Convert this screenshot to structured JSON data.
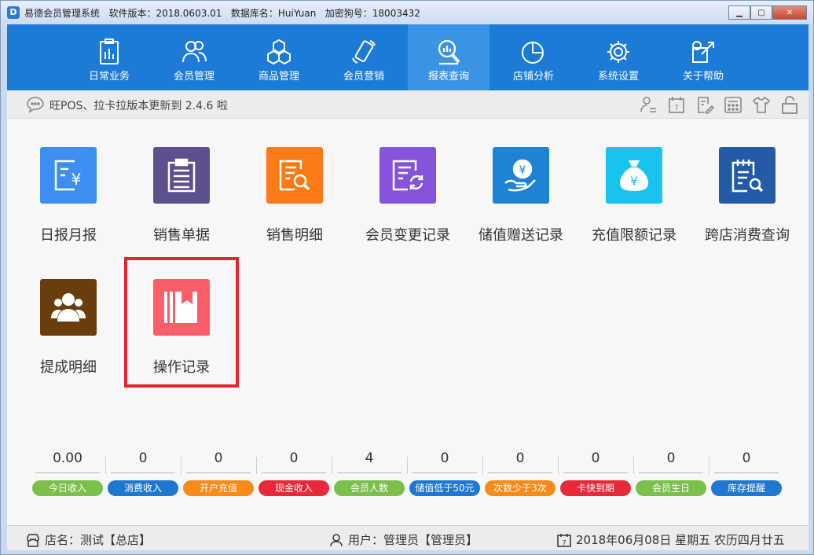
{
  "window": {
    "title": "易德会员管理系统   软件版本：2018.0603.01   数据库名：HuiYuan   加密狗号：18003432",
    "app_icon_glyph": "D"
  },
  "nav": {
    "items": [
      {
        "label": "日常业务",
        "icon": "clipboard-chart-icon"
      },
      {
        "label": "会员管理",
        "icon": "users-icon"
      },
      {
        "label": "商品管理",
        "icon": "boxes-icon"
      },
      {
        "label": "会员营销",
        "icon": "phone-icon"
      },
      {
        "label": "报表查询",
        "icon": "search-chart-icon"
      },
      {
        "label": "店铺分析",
        "icon": "pie-chart-icon"
      },
      {
        "label": "系统设置",
        "icon": "gear-icon"
      },
      {
        "label": "关于帮助",
        "icon": "help-icon"
      }
    ],
    "active_index": 4
  },
  "notice": {
    "text": "旺POS、拉卡拉版本更新到 2.4.6 啦",
    "icon": "chat-icon",
    "tools": [
      "user-switch-icon",
      "calendar-icon",
      "edit-icon",
      "calculator-icon",
      "shirt-icon",
      "lock-icon"
    ]
  },
  "reports": [
    {
      "label": "日报月报",
      "color": "#3d8ef0",
      "icon": "daily-report-icon"
    },
    {
      "label": "销售单据",
      "color": "#5e4f8e",
      "icon": "sales-receipt-icon"
    },
    {
      "label": "销售明细",
      "color": "#fb7a16",
      "icon": "sales-detail-icon"
    },
    {
      "label": "会员变更记录",
      "color": "#8653dc",
      "icon": "member-change-icon"
    },
    {
      "label": "储值赠送记录",
      "color": "#1e83d4",
      "icon": "stored-value-gift-icon"
    },
    {
      "label": "充值限额记录",
      "color": "#18c4ee",
      "icon": "money-bag-icon"
    },
    {
      "label": "跨店消费查询",
      "color": "#235ba7",
      "icon": "cross-store-icon"
    },
    {
      "label": "提成明细",
      "color": "#6a3e0c",
      "icon": "commission-icon"
    },
    {
      "label": "操作记录",
      "color": "#fb5e6b",
      "icon": "operation-log-icon"
    }
  ],
  "stats": [
    {
      "value": "0.00",
      "label": "今日收入",
      "color": "#7ac04a"
    },
    {
      "value": "0",
      "label": "消费收入",
      "color": "#1e78d2"
    },
    {
      "value": "0",
      "label": "开户充值",
      "color": "#f88a18"
    },
    {
      "value": "0",
      "label": "现金收入",
      "color": "#e8293a"
    },
    {
      "value": "4",
      "label": "会员人数",
      "color": "#7ac04a"
    },
    {
      "value": "0",
      "label": "储值低于50元",
      "color": "#1e78d2"
    },
    {
      "value": "0",
      "label": "次数少于3次",
      "color": "#f88a18"
    },
    {
      "value": "0",
      "label": "卡快到期",
      "color": "#e8293a"
    },
    {
      "value": "0",
      "label": "会员生日",
      "color": "#7ac04a"
    },
    {
      "value": "0",
      "label": "库存提醒",
      "color": "#1e78d2"
    }
  ],
  "footer": {
    "store": "店名：测试【总店】",
    "user": "用户：管理员【管理员】",
    "date": "2018年06月08日 星期五 农历四月廿五"
  }
}
